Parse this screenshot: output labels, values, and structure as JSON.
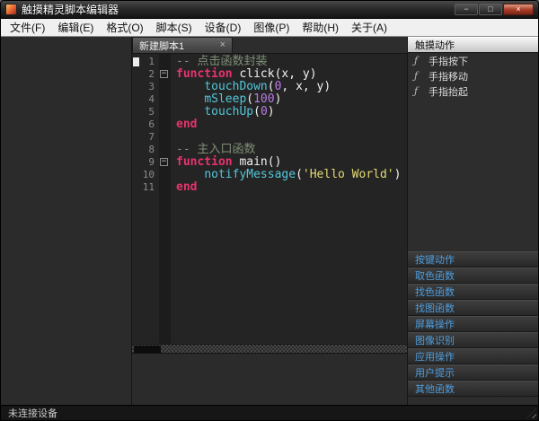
{
  "window": {
    "title": "触摸精灵脚本编辑器",
    "controls": [
      {
        "name": "minimize",
        "glyph": "−"
      },
      {
        "name": "maximize",
        "glyph": "□"
      },
      {
        "name": "close",
        "glyph": "×"
      }
    ]
  },
  "menubar": {
    "items": [
      "文件(F)",
      "编辑(E)",
      "格式(O)",
      "脚本(S)",
      "设备(D)",
      "图像(P)",
      "帮助(H)",
      "关于(A)"
    ]
  },
  "editor": {
    "tab": {
      "label": "新建脚本1",
      "close_glyph": "×"
    },
    "language": "lua",
    "lines": [
      {
        "n": 1,
        "marker": true,
        "segments": [
          {
            "t": "-- 点击函数封装",
            "c": "comment"
          }
        ]
      },
      {
        "n": 2,
        "fold": true,
        "segments": [
          {
            "t": "function",
            "c": "keyword"
          },
          {
            "t": " click(x, y)",
            "c": "plain"
          }
        ]
      },
      {
        "n": 3,
        "segments": [
          {
            "t": "    ",
            "c": "plain"
          },
          {
            "t": "touchDown",
            "c": "builtin"
          },
          {
            "t": "(",
            "c": "plain"
          },
          {
            "t": "0",
            "c": "number"
          },
          {
            "t": ", x, y)",
            "c": "plain"
          }
        ]
      },
      {
        "n": 4,
        "segments": [
          {
            "t": "    ",
            "c": "plain"
          },
          {
            "t": "mSleep",
            "c": "builtin"
          },
          {
            "t": "(",
            "c": "plain"
          },
          {
            "t": "100",
            "c": "number"
          },
          {
            "t": ")",
            "c": "plain"
          }
        ]
      },
      {
        "n": 5,
        "segments": [
          {
            "t": "    ",
            "c": "plain"
          },
          {
            "t": "touchUp",
            "c": "builtin"
          },
          {
            "t": "(",
            "c": "plain"
          },
          {
            "t": "0",
            "c": "number"
          },
          {
            "t": ")",
            "c": "plain"
          }
        ]
      },
      {
        "n": 6,
        "segments": [
          {
            "t": "end",
            "c": "keyword"
          }
        ]
      },
      {
        "n": 7,
        "segments": []
      },
      {
        "n": 8,
        "segments": [
          {
            "t": "-- 主入口函数",
            "c": "comment"
          }
        ]
      },
      {
        "n": 9,
        "fold": true,
        "segments": [
          {
            "t": "function",
            "c": "keyword"
          },
          {
            "t": " main()",
            "c": "plain"
          }
        ]
      },
      {
        "n": 10,
        "segments": [
          {
            "t": "    ",
            "c": "plain"
          },
          {
            "t": "notifyMessage",
            "c": "builtin"
          },
          {
            "t": "(",
            "c": "plain"
          },
          {
            "t": "'Hello World'",
            "c": "string"
          },
          {
            "t": ")",
            "c": "plain"
          }
        ]
      },
      {
        "n": 11,
        "segments": [
          {
            "t": "end",
            "c": "keyword"
          }
        ]
      }
    ]
  },
  "right_panel": {
    "active_section": {
      "label": "触摸动作",
      "items": [
        {
          "icon": "ƒ",
          "label": "手指按下"
        },
        {
          "icon": "ƒ",
          "label": "手指移动"
        },
        {
          "icon": "ƒ",
          "label": "手指抬起"
        }
      ]
    },
    "collapsed_sections": [
      "按键动作",
      "取色函数",
      "找色函数",
      "找图函数",
      "屏幕操作",
      "图像识别",
      "应用操作",
      "用户提示",
      "其他函数"
    ]
  },
  "statusbar": {
    "text": "未连接设备"
  },
  "colors": {
    "keyword": "#e8336d",
    "builtin": "#52c7da",
    "number": "#bd7ae8",
    "string": "#e6db74",
    "comment": "#7f8f77",
    "plain": "#f2f2f2",
    "accent_blue": "#4f9ddd"
  }
}
